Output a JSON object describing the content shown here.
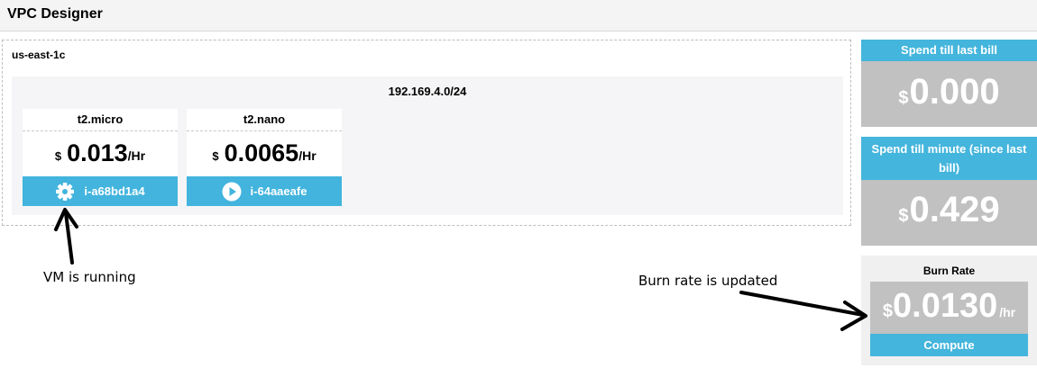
{
  "header": {
    "title": "VPC Designer"
  },
  "az": {
    "label": "us-east-1c",
    "subnet": {
      "cidr": "192.169.4.0/24",
      "instances": [
        {
          "type": "t2.micro",
          "currency": "$",
          "price": "0.013",
          "unit": "/Hr",
          "id": "i-a68bd1a4",
          "status_icon": "gear-icon"
        },
        {
          "type": "t2.nano",
          "currency": "$",
          "price": "0.0065",
          "unit": "/Hr",
          "id": "i-64aaeafe",
          "status_icon": "play-icon"
        }
      ]
    }
  },
  "spend_last_bill": {
    "title": "Spend till last bill",
    "currency": "$",
    "amount": "0.000"
  },
  "spend_minute": {
    "title_line1": "Spend till minute (since last",
    "title_line2": "bill)",
    "currency": "$",
    "amount": "0.429"
  },
  "burn_rate": {
    "title": "Burn Rate",
    "currency": "$",
    "amount": "0.0130",
    "unit": "/hr",
    "footer": "Compute"
  },
  "annotations": {
    "vm_running": "VM is running",
    "burn_updated": "Burn rate is updated"
  },
  "colors": {
    "accent": "#42b4dd",
    "value_box": "#c1c1c1"
  }
}
